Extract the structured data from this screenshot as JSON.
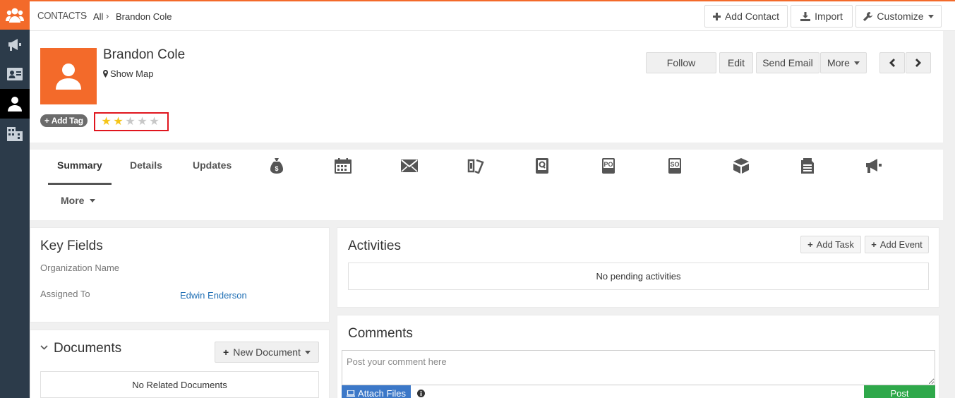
{
  "breadcrumb": {
    "module": "CONTACTS",
    "all": "All",
    "record": "Brandon Cole"
  },
  "top_actions": {
    "add_contact": "Add Contact",
    "import": "Import",
    "customize": "Customize"
  },
  "record": {
    "name": "Brandon Cole",
    "show_map": "Show Map",
    "add_tag": "Add Tag",
    "rating": {
      "value": 2,
      "max": 5
    },
    "actions": {
      "follow": "Follow",
      "edit": "Edit",
      "send_email": "Send Email",
      "more": "More"
    }
  },
  "tabs": {
    "summary": "Summary",
    "details": "Details",
    "updates": "Updates",
    "more": "More",
    "icons": [
      "money-bag-icon",
      "calendar-icon",
      "envelope-icon",
      "tickets-icon",
      "quote-icon",
      "purchase-order-icon",
      "sales-order-icon",
      "products-box-icon",
      "invoice-document-icon",
      "campaign-megaphone-icon"
    ],
    "icon_po": "PO",
    "icon_so": "SO"
  },
  "key_fields": {
    "title": "Key Fields",
    "org_label": "Organization Name",
    "assigned_label": "Assigned To",
    "assigned_value": "Edwin Enderson"
  },
  "documents": {
    "title": "Documents",
    "new_document": "New Document",
    "empty": "No Related Documents"
  },
  "activities": {
    "title": "Activities",
    "add_task": "Add Task",
    "add_event": "Add Event",
    "empty": "No pending activities"
  },
  "comments": {
    "title": "Comments",
    "placeholder": "Post your comment here",
    "attach_files": "Attach Files",
    "post": "Post"
  },
  "colors": {
    "accent": "#f36a2a",
    "sidebar": "#2c3b4a",
    "star_on": "#f5c518",
    "star_off": "#c8c8c8",
    "post_green": "#2ea84a",
    "attach_blue": "#3c78c8",
    "highlight": "#e0161e"
  }
}
